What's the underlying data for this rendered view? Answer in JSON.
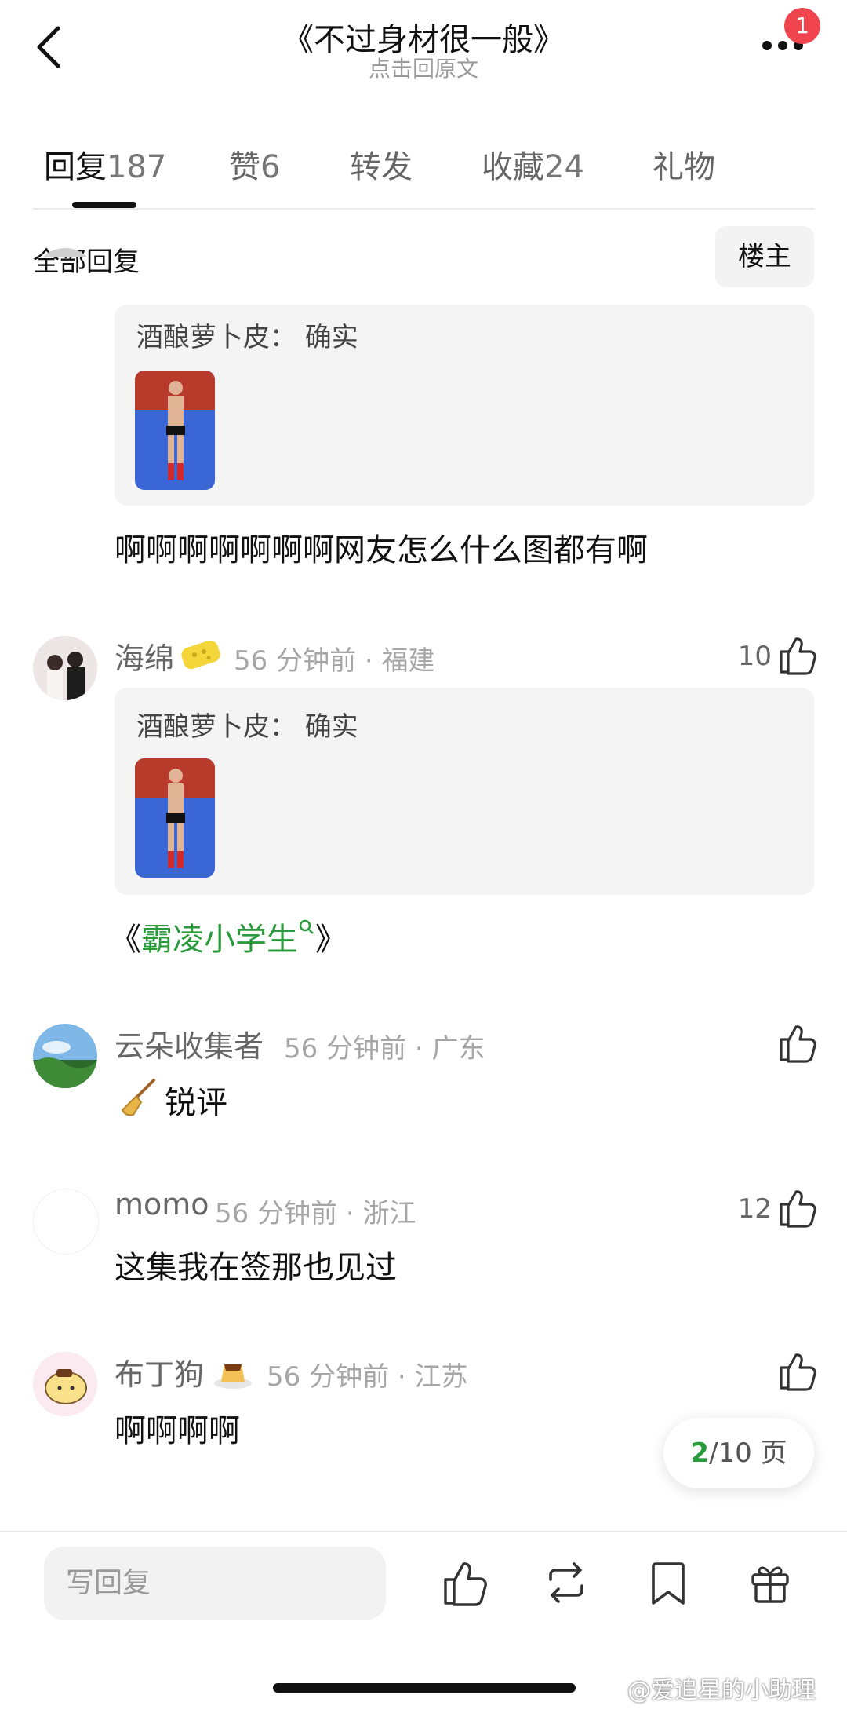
{
  "header": {
    "title": "《不过身材很一般》",
    "subtitle": "点击回原文",
    "notification_count": "1"
  },
  "tabs": [
    {
      "label": "回复",
      "count": "187",
      "active": true
    },
    {
      "label": "赞",
      "count": "6",
      "active": false
    },
    {
      "label": "转发",
      "count": "",
      "active": false
    },
    {
      "label": "收藏",
      "count": "24",
      "active": false
    },
    {
      "label": "礼物",
      "count": "",
      "active": false
    }
  ],
  "filter": {
    "label": "全部回复",
    "louzhu_button": "楼主"
  },
  "comments": [
    {
      "quote": "酒酿萝卜皮：  确实",
      "text": "啊啊啊啊啊啊啊网友怎么什么图都有啊"
    },
    {
      "user": "海绵",
      "time": "56 分钟前 · 福建",
      "likes": "10",
      "quote": "酒酿萝卜皮：  确实",
      "text_prefix": "《",
      "text_link": "霸凌小学生",
      "text_suffix": "》"
    },
    {
      "user": "云朵收集者",
      "time": "56 分钟前 · 广东",
      "likes": "",
      "text": "锐评"
    },
    {
      "user": "momo",
      "time": "56 分钟前 · 浙江",
      "likes": "12",
      "text": "这集我在签那也见过"
    },
    {
      "user": "布丁狗",
      "time": "56 分钟前 · 江苏",
      "likes": "",
      "text": "啊啊啊啊"
    }
  ],
  "pager": {
    "current": "2",
    "total": "/10 页"
  },
  "bottom_bar": {
    "reply_placeholder": "写回复",
    "icons": [
      "like-icon",
      "repost-icon",
      "bookmark-icon",
      "gift-icon"
    ]
  },
  "watermark": "@爱追星的小助理",
  "colors": {
    "accent_green": "#2a9b3b",
    "badge_red": "#f0454e"
  }
}
